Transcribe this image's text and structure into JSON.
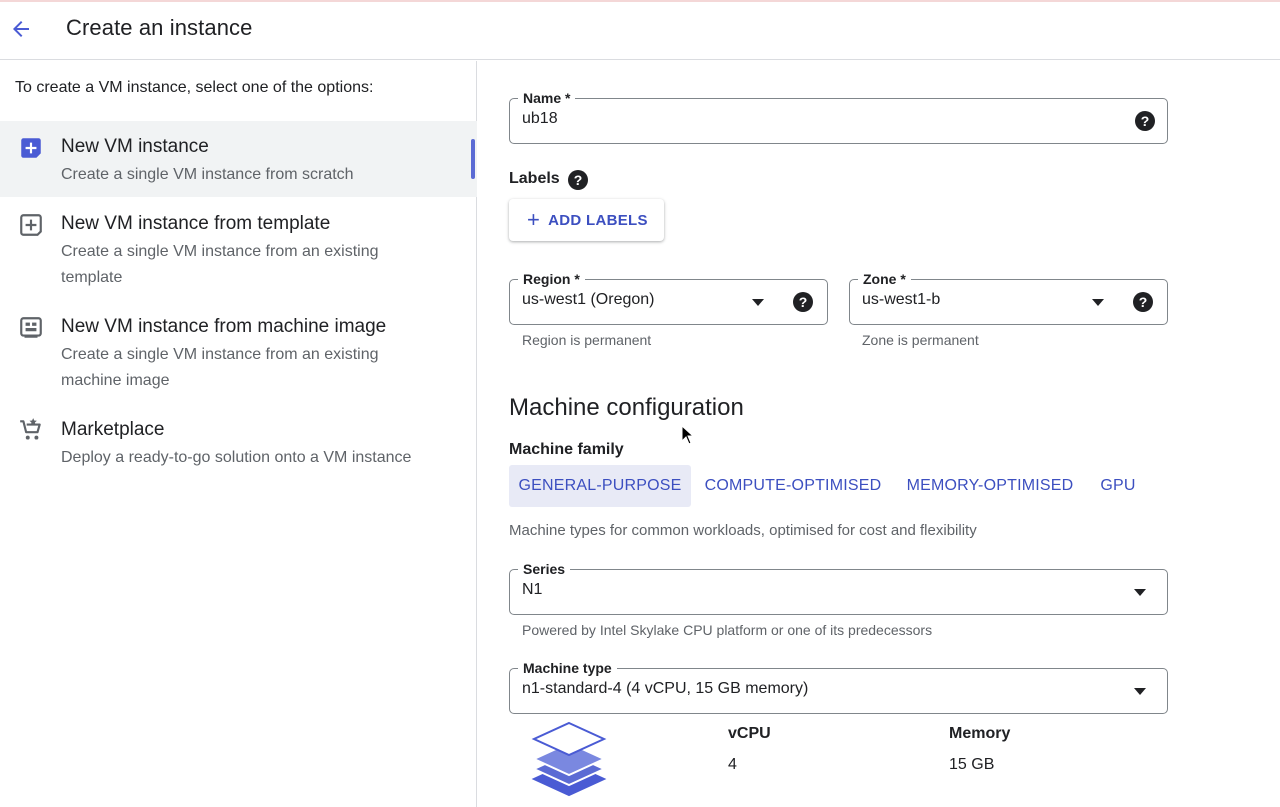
{
  "header": {
    "title": "Create an instance"
  },
  "left": {
    "intro": "To create a VM instance, select one of the options:",
    "options": [
      {
        "title": "New VM instance",
        "desc": "Create a single VM instance from scratch",
        "icon": "add-box-icon",
        "selected": true
      },
      {
        "title": "New VM instance from template",
        "desc": "Create a single VM instance from an existing template",
        "icon": "template-icon",
        "selected": false
      },
      {
        "title": "New VM instance from machine image",
        "desc": "Create a single VM instance from an existing machine image",
        "icon": "machine-image-icon",
        "selected": false
      },
      {
        "title": "Marketplace",
        "desc": "Deploy a ready-to-go solution onto a VM instance",
        "icon": "cart-icon",
        "selected": false
      }
    ]
  },
  "form": {
    "name": {
      "label": "Name *",
      "value": "ub18"
    },
    "labels": {
      "title": "Labels",
      "add_button": "ADD LABELS"
    },
    "region": {
      "label": "Region *",
      "value": "us-west1 (Oregon)",
      "hint": "Region is permanent"
    },
    "zone": {
      "label": "Zone *",
      "value": "us-west1-b",
      "hint": "Zone is permanent"
    },
    "machine": {
      "section_title": "Machine configuration",
      "family_label": "Machine family",
      "tabs": [
        "GENERAL-PURPOSE",
        "COMPUTE-OPTIMISED",
        "MEMORY-OPTIMISED",
        "GPU"
      ],
      "active_tab": "GENERAL-PURPOSE",
      "family_desc": "Machine types for common workloads, optimised for cost and flexibility",
      "series": {
        "label": "Series",
        "value": "N1",
        "hint": "Powered by Intel Skylake CPU platform or one of its predecessors"
      },
      "machine_type": {
        "label": "Machine type",
        "value": "n1-standard-4 (4 vCPU, 15 GB memory)"
      },
      "specs": {
        "vcpu_label": "vCPU",
        "vcpu_value": "4",
        "memory_label": "Memory",
        "memory_value": "15 GB"
      }
    }
  },
  "icons": {
    "help": "?"
  },
  "colors": {
    "accent": "#3c4fc0",
    "selected_bg": "#f1f3f4",
    "active_tab_bg": "#e8eaf6",
    "icon_blue": "#4a5bd4"
  }
}
